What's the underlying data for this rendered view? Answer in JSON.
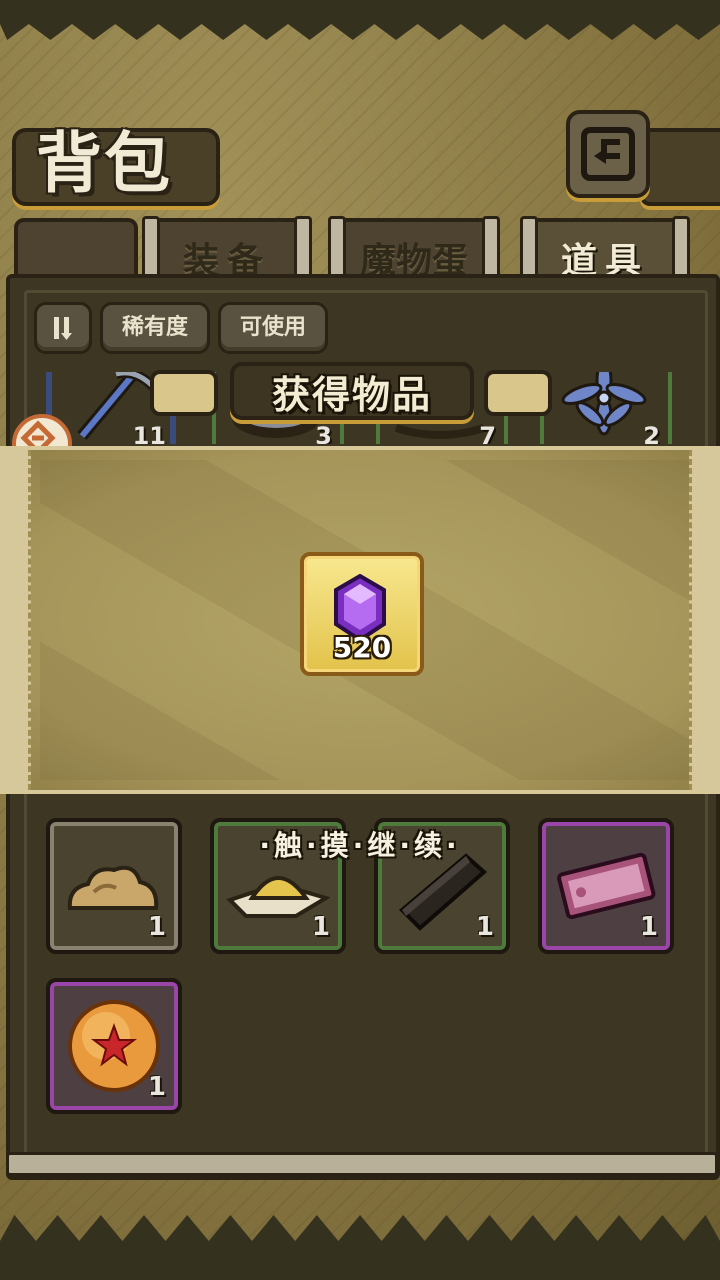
{
  "header": {
    "title": "背包",
    "back_icon": "back-arrow-icon"
  },
  "tabs": [
    {
      "label": "装备",
      "active": false
    },
    {
      "label": "魔物蛋",
      "active": false
    },
    {
      "label": "道具",
      "active": true
    }
  ],
  "filters": {
    "sort_icon": "pause-sort-icon",
    "rarity": "稀有度",
    "usable": "可使用"
  },
  "peek_items": [
    {
      "name": "pickaxe",
      "count": "11"
    },
    {
      "name": "pan",
      "count": "3"
    },
    {
      "name": "unknown",
      "count": "7"
    },
    {
      "name": "blue-flower",
      "count": "2"
    }
  ],
  "popup": {
    "title": "获得物品",
    "reward": {
      "icon": "purple-gem-icon",
      "count": "520"
    }
  },
  "tap_hint": "·触·摸·继·续·",
  "items": [
    {
      "icon": "rock-pile-icon",
      "count": "1",
      "rarity": "gray"
    },
    {
      "icon": "sand-pile-icon",
      "count": "1",
      "rarity": "green"
    },
    {
      "icon": "wood-plank-icon",
      "count": "1",
      "rarity": "green"
    },
    {
      "icon": "ticket-icon",
      "count": "1",
      "rarity": "purple"
    },
    {
      "icon": "star-orb-icon",
      "count": "1",
      "rarity": "purple"
    }
  ]
}
